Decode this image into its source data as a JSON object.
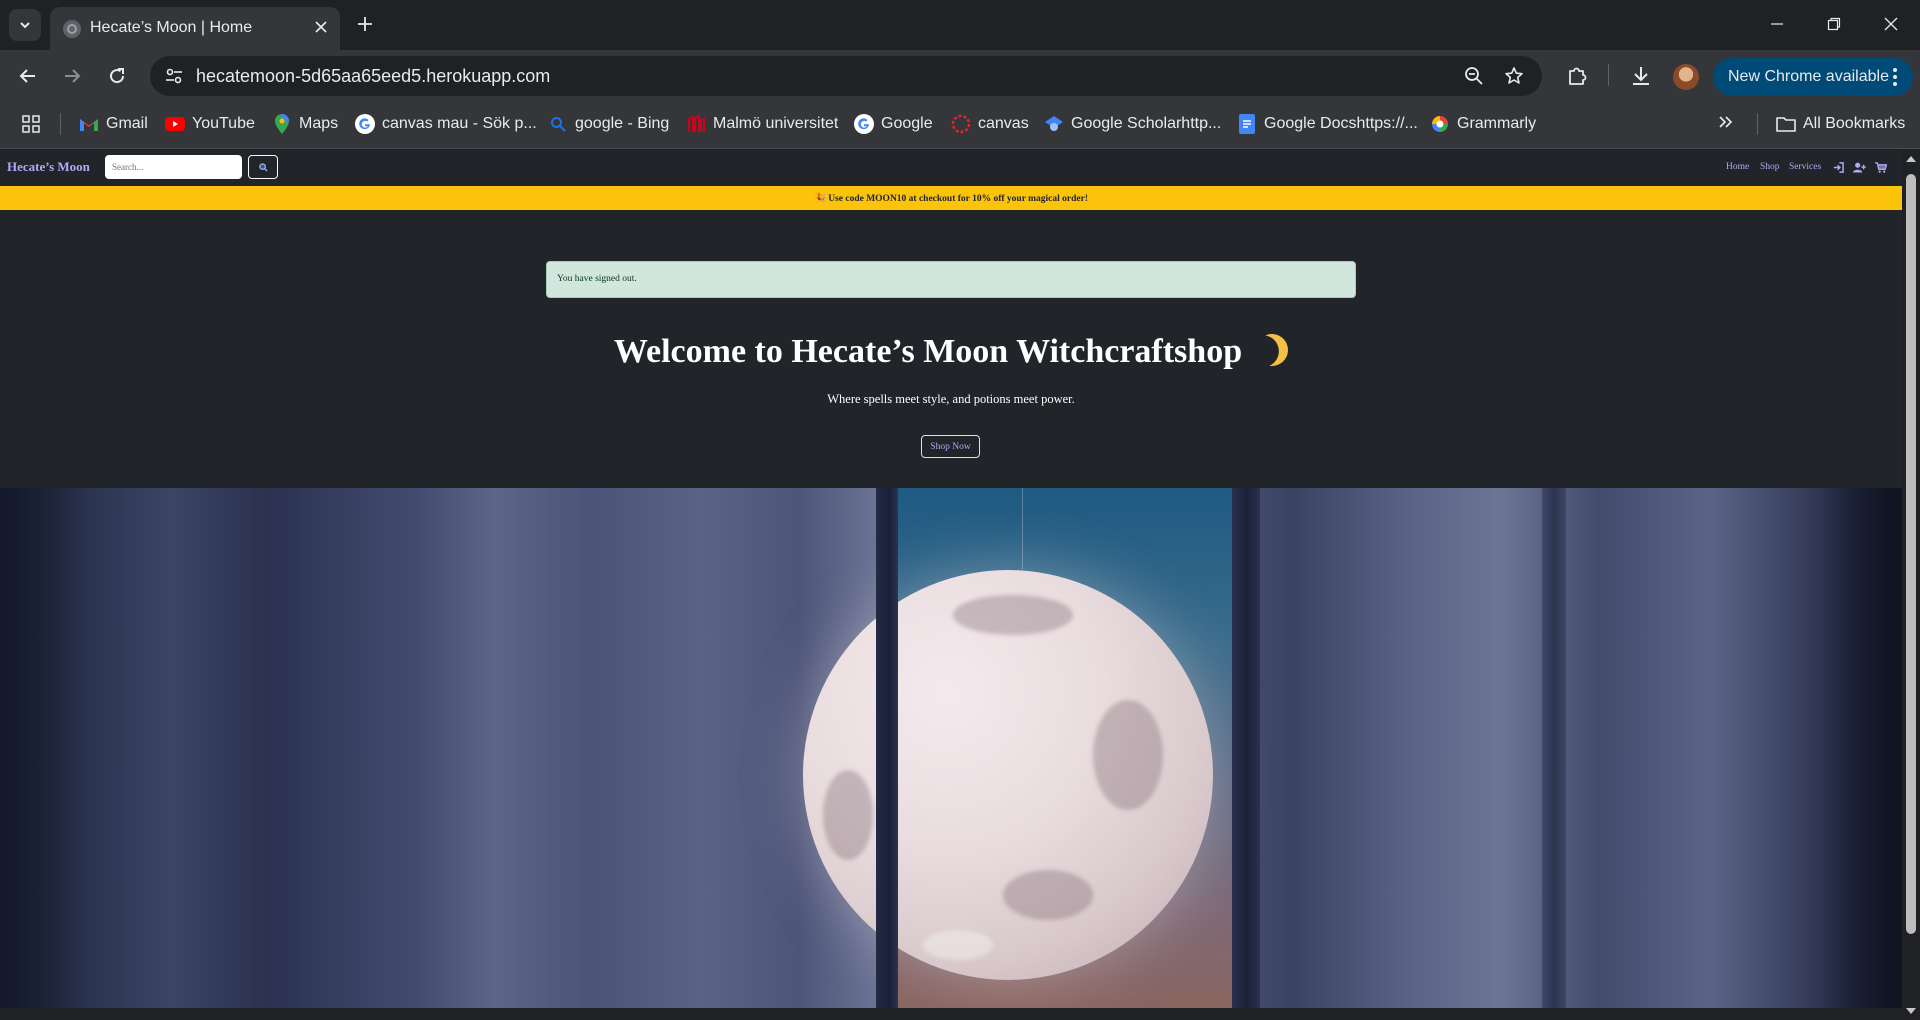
{
  "browser": {
    "tab_title": "Hecate’s Moon | Home",
    "url": "hecatemoon-5d65aa65eed5.herokuapp.com",
    "update_label": "New Chrome available",
    "bookmarks": [
      {
        "label": "Gmail",
        "icon": "gmail-icon",
        "color": "#ea4335"
      },
      {
        "label": "YouTube",
        "icon": "youtube-icon",
        "color": "#ff0000"
      },
      {
        "label": "Maps",
        "icon": "maps-icon",
        "color": "#34a853"
      },
      {
        "label": "canvas mau - Sök p...",
        "icon": "google-icon",
        "color": "#4285f4"
      },
      {
        "label": "google - Bing",
        "icon": "bing-search-icon",
        "color": "#1a73e8"
      },
      {
        "label": "Malmö universitet",
        "icon": "malmo-university-icon",
        "color": "#d0021b"
      },
      {
        "label": "Google",
        "icon": "google-icon",
        "color": "#4285f4"
      },
      {
        "label": "canvas",
        "icon": "canvas-icon",
        "color": "#e72429"
      },
      {
        "label": "Google Scholarhttp...",
        "icon": "scholar-icon",
        "color": "#4285f4"
      },
      {
        "label": "Google Docshttps://...",
        "icon": "docs-icon",
        "color": "#4285f4"
      },
      {
        "label": "Grammarly",
        "icon": "grammarly-icon",
        "color": "#15c39a"
      }
    ],
    "all_bookmarks_label": "All Bookmarks"
  },
  "site": {
    "brand": "Hecate’s Moon",
    "search_placeholder": "Search...",
    "nav": {
      "home": "Home",
      "shop": "Shop",
      "services": "Services"
    },
    "promo": "🎉 Use code MOON10 at checkout for 10% off your magical order!",
    "alert": "You have signed out.",
    "hero": {
      "title": "Welcome to Hecate’s Moon Witchcraftshop",
      "tagline": "Where spells meet style, and potions meet power.",
      "cta": "Shop Now"
    },
    "colors": {
      "accent": "#b4a7f5",
      "promo_bg": "#fbc30a",
      "alert_bg": "#d1e7dd",
      "page_bg": "#212529"
    }
  }
}
